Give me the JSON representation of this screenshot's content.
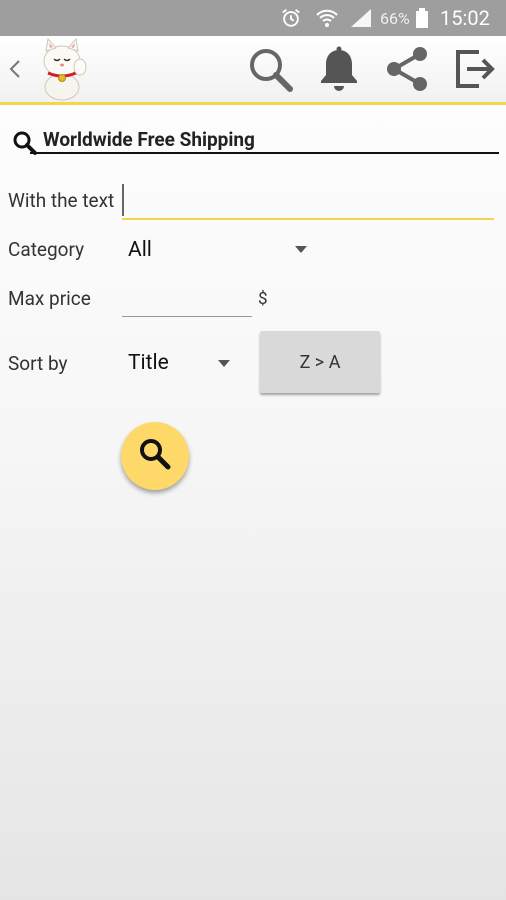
{
  "status_bar": {
    "battery_percent": "66%",
    "time": "15:02"
  },
  "app_bar": {
    "back_icon": "chevron-left-icon",
    "logo_icon": "lucky-cat-logo",
    "actions": [
      "search-icon",
      "bell-icon",
      "share-icon",
      "exit-icon"
    ]
  },
  "search": {
    "title": "Worldwide Free Shipping"
  },
  "form": {
    "text_label": "With the text",
    "text_value": "",
    "category_label": "Category",
    "category_value": "All",
    "max_price_label": "Max price",
    "max_price_value": "",
    "currency_symbol": "$",
    "sort_label": "Sort by",
    "sort_value": "Title",
    "sort_order_label": "Z > A"
  },
  "colors": {
    "accent": "#f5d64a",
    "fab": "#ffd86a",
    "status_bar": "#9e9e9e"
  }
}
